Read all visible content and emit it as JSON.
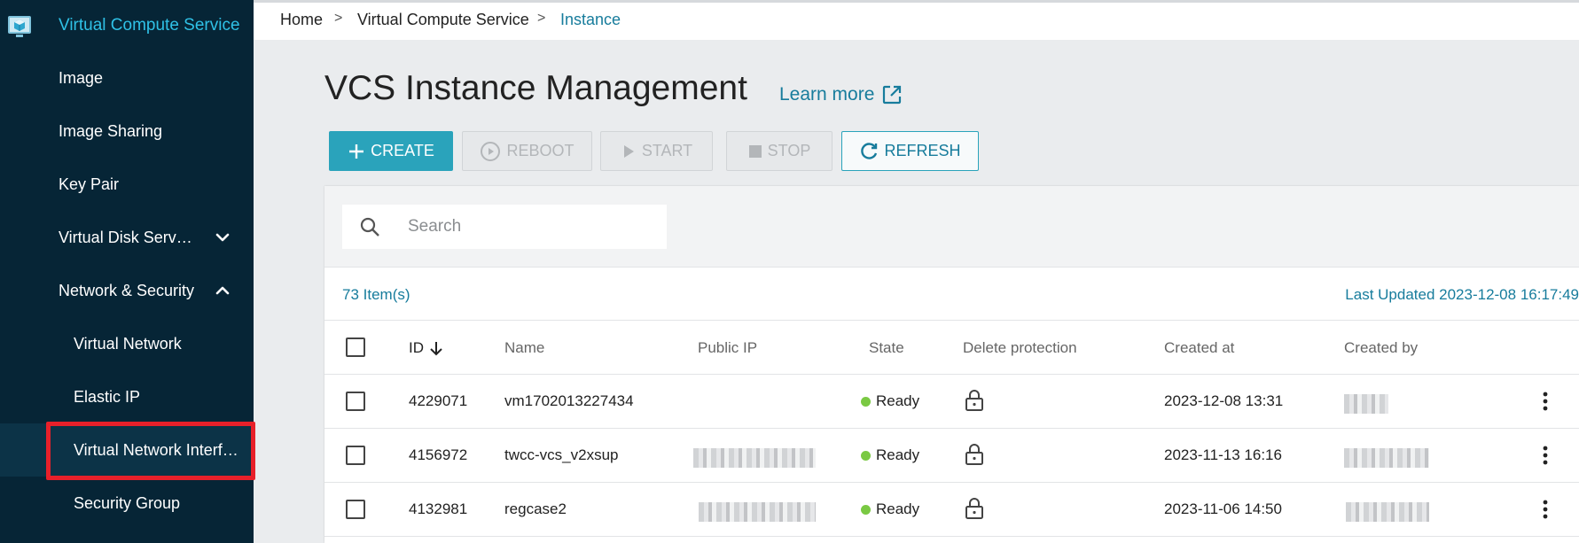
{
  "sidebar": {
    "header_title": "Virtual Compute Service",
    "items": [
      {
        "label": "Image"
      },
      {
        "label": "Image Sharing"
      },
      {
        "label": "Key Pair"
      },
      {
        "label": "Virtual Disk Serv…",
        "chevron": "chevron-down-icon"
      },
      {
        "label": "Network & Security",
        "chevron": "chevron-up-icon"
      },
      {
        "label": "Virtual Network"
      },
      {
        "label": "Elastic IP"
      },
      {
        "label": "Virtual Network Interf…"
      },
      {
        "label": "Security Group"
      }
    ],
    "highlight_color": "#e8202a"
  },
  "breadcrumb": {
    "home": "Home",
    "separator": ">",
    "section": "Virtual Compute Service",
    "current": "Instance"
  },
  "page": {
    "title": "VCS Instance Management",
    "learn_more": "Learn more"
  },
  "toolbar": {
    "create": "CREATE",
    "reboot": "REBOOT",
    "start": "START",
    "stop": "STOP",
    "refresh": "REFRESH",
    "accent_color": "#2aa3bb"
  },
  "search": {
    "placeholder": "Search"
  },
  "summary": {
    "count": "73 Item(s)",
    "last_updated": "Last Updated 2023-12-08 16:17:49"
  },
  "table": {
    "columns": {
      "id": "ID",
      "name": "Name",
      "public_ip": "Public IP",
      "state": "State",
      "delete_protection": "Delete protection",
      "created_at": "Created at",
      "created_by": "Created by"
    },
    "rows": [
      {
        "id": "4229071",
        "name": "vm1702013227434",
        "state": "Ready",
        "created_at": "2023-12-08 13:31"
      },
      {
        "id": "4156972",
        "name": "twcc-vcs_v2xsup",
        "state": "Ready",
        "created_at": "2023-11-13 16:16"
      },
      {
        "id": "4132981",
        "name": "regcase2",
        "state": "Ready",
        "created_at": "2023-11-06 14:50"
      }
    ],
    "state_color": "#7ac943"
  }
}
